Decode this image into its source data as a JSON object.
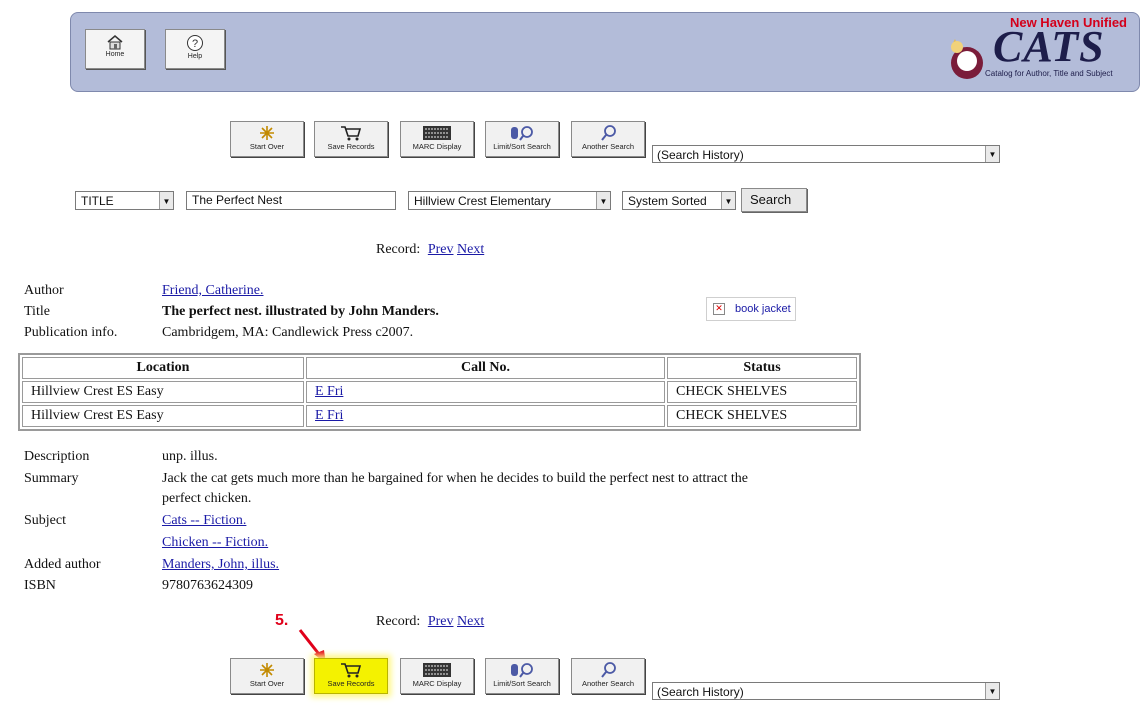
{
  "header": {
    "home_label": "Home",
    "help_label": "Help",
    "logo_tagline": "New Haven Unified",
    "logo_name": "CATS",
    "logo_subtitle": "Catalog for Author, Title and Subject"
  },
  "toolbar": {
    "start_over": "Start Over",
    "save_records": "Save Records",
    "marc_display": "MARC Display",
    "limit_sort": "Limit/Sort Search",
    "another_search": "Another Search",
    "history_select": "(Search History)"
  },
  "search": {
    "field_select": "TITLE",
    "query": "The Perfect Nest",
    "library_select": "Hillview Crest Elementary",
    "sort_select": "System Sorted",
    "search_button": "Search"
  },
  "record_nav": {
    "label": "Record:",
    "prev": "Prev",
    "next": "Next"
  },
  "record": {
    "author_label": "Author",
    "author": "Friend, Catherine.",
    "title_label": "Title",
    "title": "The perfect nest. illustrated by John Manders.",
    "pub_label": "Publication info.",
    "pub": "Cambridgem, MA: Candlewick Press c2007.",
    "jacket": "book jacket"
  },
  "holdings": {
    "headers": [
      "Location",
      "Call No.",
      "Status"
    ],
    "rows": [
      [
        "Hillview Crest ES Easy",
        "E Fri",
        "CHECK SHELVES"
      ],
      [
        "Hillview Crest ES Easy",
        "E Fri",
        "CHECK SHELVES"
      ]
    ]
  },
  "details": {
    "description_label": "Description",
    "description": "unp. illus.",
    "summary_label": "Summary",
    "summary_line1": "Jack the cat gets much more than he bargained for when he decides to build the perfect nest to attract the",
    "summary_line2": "perfect chicken.",
    "subject_label": "Subject",
    "subject1": "Cats -- Fiction.",
    "subject2": "Chicken -- Fiction.",
    "added_author_label": "Added author",
    "added_author": "Manders, John, illus.",
    "isbn_label": "ISBN",
    "isbn": "9780763624309"
  },
  "annotation": {
    "step": "5."
  },
  "colors": {
    "banner": "#b3bcd9",
    "highlight": "#f4f200",
    "annotation_red": "#e0001a",
    "link": "#1a1aa6"
  }
}
